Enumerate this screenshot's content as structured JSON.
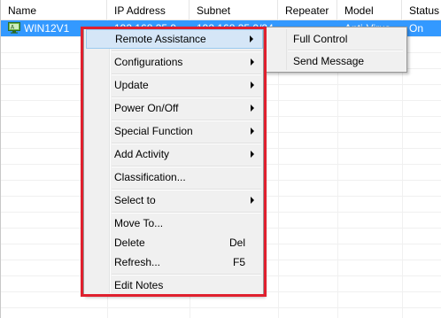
{
  "columns": [
    {
      "key": "name",
      "label": "Name"
    },
    {
      "key": "ip",
      "label": "IP Address"
    },
    {
      "key": "subnet",
      "label": "Subnet"
    },
    {
      "key": "repeater",
      "label": "Repeater"
    },
    {
      "key": "model",
      "label": "Model"
    },
    {
      "key": "status",
      "label": "Status"
    }
  ],
  "selected_row": {
    "name": "WIN12V1",
    "ip": "192.168.35.9",
    "subnet": "192.168.35.0/24",
    "repeater": "",
    "model": "Anti-Virus",
    "status": "On",
    "icon": "computer-icon"
  },
  "context_menu": {
    "items": [
      {
        "label": "Remote Assistance",
        "has_submenu": true,
        "highlighted": true
      },
      {
        "label": "Configurations",
        "has_submenu": true
      },
      {
        "label": "Update",
        "has_submenu": true
      },
      {
        "label": "Power On/Off",
        "has_submenu": true
      },
      {
        "label": "Special Function",
        "has_submenu": true
      },
      {
        "label": "Add Activity",
        "has_submenu": true
      },
      {
        "label": "Classification...",
        "has_submenu": false
      },
      {
        "label": "Select to",
        "has_submenu": true
      },
      {
        "label": "Move To...",
        "has_submenu": false
      },
      {
        "label": "Delete",
        "shortcut": "Del"
      },
      {
        "label": "Refresh...",
        "shortcut": "F5"
      },
      {
        "label": "Edit Notes",
        "has_submenu": false
      }
    ]
  },
  "submenu": {
    "items": [
      {
        "label": "Full Control"
      },
      {
        "label": "Send Message"
      }
    ]
  },
  "colors": {
    "selection": "#3399ff",
    "menu_highlight": "#d5e6f7",
    "annotation_box": "#e0202e"
  }
}
